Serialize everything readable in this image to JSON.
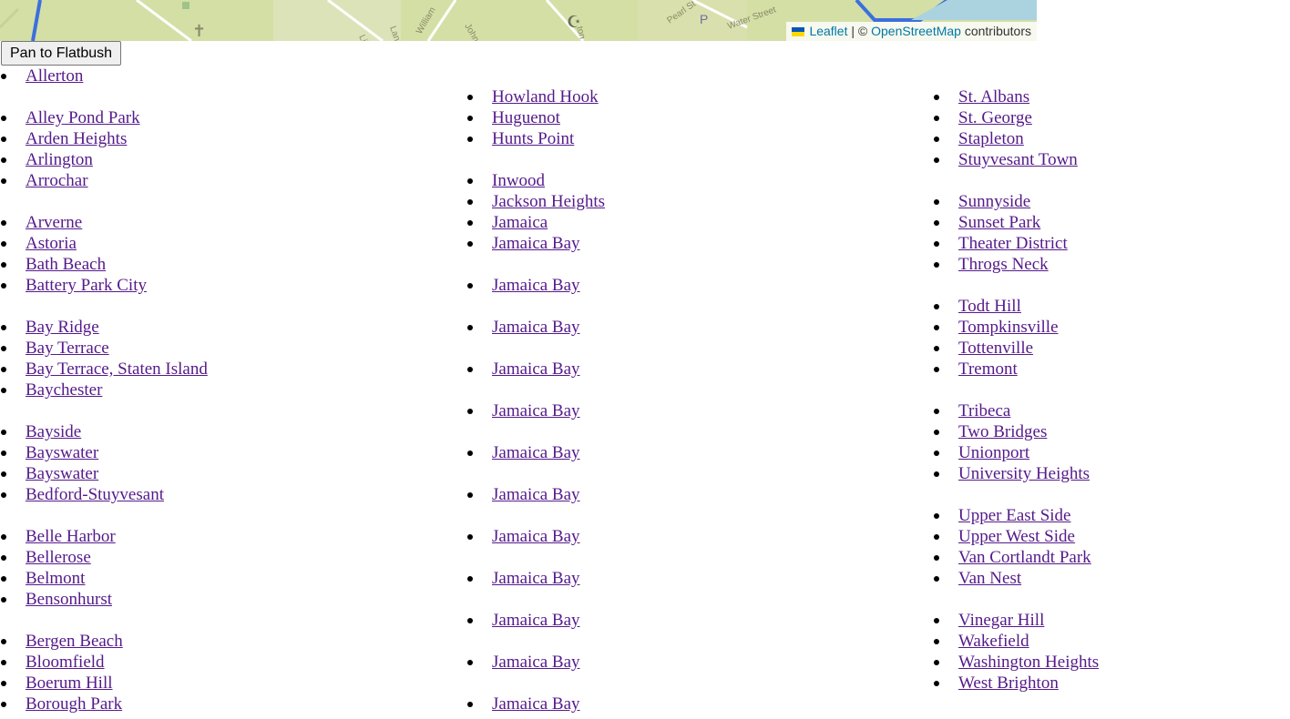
{
  "map": {
    "streets": [
      "Liberty Street",
      "Lane",
      "William",
      "John Street",
      "Pearl St",
      "Water Street",
      "ton St"
    ],
    "attribution": {
      "leaflet": "Leaflet",
      "separator": "| ©",
      "osm": "OpenStreetMap",
      "suffix": "contributors"
    }
  },
  "controls": {
    "pan_button": "Pan to Flatbush"
  },
  "columns": [
    [
      "Allerton",
      "Alley Pond Park",
      "Arden Heights",
      "Arlington",
      "Arrochar",
      "Arverne",
      "Astoria",
      "Bath Beach",
      "Battery Park City",
      "Bay Ridge",
      "Bay Terrace",
      "Bay Terrace, Staten Island",
      "Baychester",
      "Bayside",
      "Bayswater",
      "Bayswater",
      "Bedford-Stuyvesant",
      "Belle Harbor",
      "Bellerose",
      "Belmont",
      "Bensonhurst",
      "Bergen Beach",
      "Bloomfield",
      "Boerum Hill",
      "Borough Park"
    ],
    [
      "Howland Hook",
      "Huguenot",
      "Hunts Point",
      "Inwood",
      "Jackson Heights",
      "Jamaica",
      "Jamaica Bay",
      "Jamaica Bay",
      "Jamaica Bay",
      "Jamaica Bay",
      "Jamaica Bay",
      "Jamaica Bay",
      "Jamaica Bay",
      "Jamaica Bay",
      "Jamaica Bay",
      "Jamaica Bay",
      "Jamaica Bay",
      "Jamaica Bay"
    ],
    [
      "St. Albans",
      "St. George",
      "Stapleton",
      "Stuyvesant Town",
      "Sunnyside",
      "Sunset Park",
      "Theater District",
      "Throgs Neck",
      "Todt Hill",
      "Tompkinsville",
      "Tottenville",
      "Tremont",
      "Tribeca",
      "Two Bridges",
      "Unionport",
      "University Heights",
      "Upper East Side",
      "Upper West Side",
      "Van Cortlandt Park",
      "Van Nest",
      "Vinegar Hill",
      "Wakefield",
      "Washington Heights",
      "West Brighton"
    ]
  ]
}
